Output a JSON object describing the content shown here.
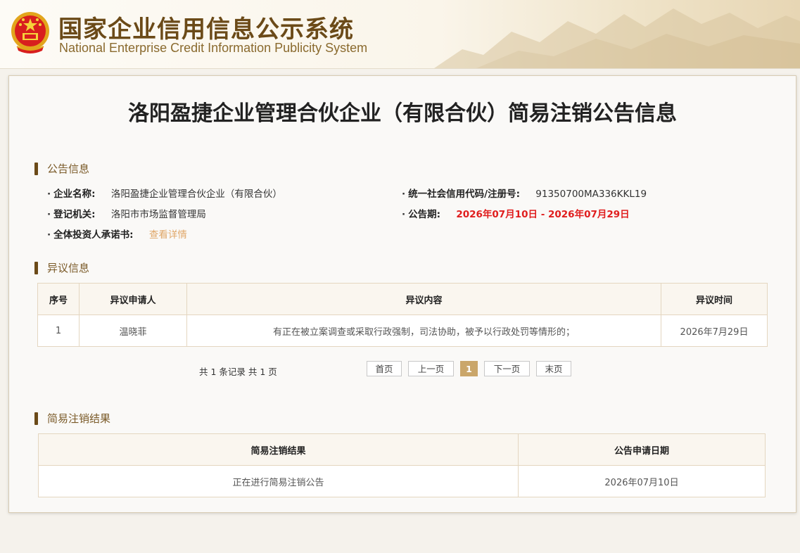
{
  "site": {
    "title_cn": "国家企业信用信息公示系统",
    "title_en": "National Enterprise Credit Information Publicity System"
  },
  "page_title": "洛阳盈捷企业管理合伙企业（有限合伙）简易注销公告信息",
  "announcement": {
    "section_title": "公告信息",
    "company_name_label": "企业名称:",
    "company_name": "洛阳盈捷企业管理合伙企业（有限合伙）",
    "credit_code_label": "统一社会信用代码/注册号:",
    "credit_code": "91350700MA336KKL19",
    "authority_label": "登记机关:",
    "authority": "洛阳市市场监督管理局",
    "period_label": "公告期:",
    "period": "2026年07月10日 - 2026年07月29日",
    "commitment_label": "全体投资人承诺书:",
    "commitment_link": "查看详情"
  },
  "objection": {
    "section_title": "异议信息",
    "columns": [
      "序号",
      "异议申请人",
      "异议内容",
      "异议时间"
    ],
    "rows": [
      [
        "1",
        "温晓菲",
        "有正在被立案调查或采取行政强制，司法协助，被予以行政处罚等情形的；",
        "2026年7月29日"
      ]
    ]
  },
  "pagination": {
    "summary": "共 1 条记录 共 1 页",
    "first": "首页",
    "prev": "上一页",
    "current": "1",
    "next": "下一页",
    "last": "末页"
  },
  "result": {
    "section_title": "简易注销结果",
    "columns": [
      "简易注销结果",
      "公告申请日期"
    ],
    "rows": [
      [
        "正在进行简易注销公告",
        "2026年07月10日"
      ]
    ]
  },
  "colors": {
    "brand_brown": "#6b4a18",
    "highlight_red": "#e01e1e",
    "link_orange": "#e0a86a",
    "active_page": "#caa66a"
  },
  "icons": {
    "emblem": "national-emblem-icon"
  }
}
